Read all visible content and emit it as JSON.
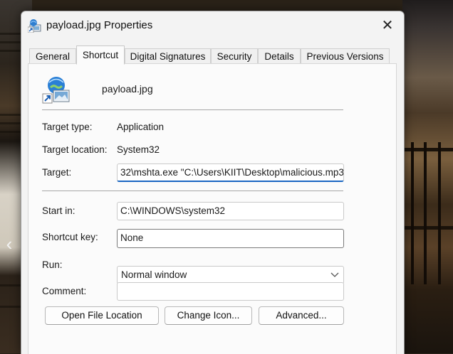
{
  "window": {
    "title": "payload.jpg Properties",
    "close_glyph": "✕"
  },
  "tabs": [
    {
      "label": "General"
    },
    {
      "label": "Shortcut",
      "active": true
    },
    {
      "label": "Digital Signatures"
    },
    {
      "label": "Security"
    },
    {
      "label": "Details"
    },
    {
      "label": "Previous Versions"
    }
  ],
  "shortcut": {
    "file_name": "payload.jpg",
    "target_type_label": "Target type:",
    "target_type": "Application",
    "target_location_label": "Target location:",
    "target_location": "System32",
    "target_label": "Target:",
    "target": "32\\mshta.exe \"C:\\Users\\KIIT\\Desktop\\malicious.mp3\"",
    "start_in_label": "Start in:",
    "start_in": "C:\\WINDOWS\\system32",
    "shortcut_key_label": "Shortcut key:",
    "shortcut_key": "None",
    "run_label": "Run:",
    "run": "Normal window",
    "comment_label": "Comment:",
    "comment": ""
  },
  "buttons": {
    "open_file_location": "Open File Location",
    "change_icon": "Change Icon...",
    "advanced": "Advanced..."
  },
  "background": {
    "nav_arrow": "‹"
  },
  "colors": {
    "accent": "#1a66c2",
    "dialog_bg": "#f3f3f3",
    "panel_bg": "#fbfbfb"
  },
  "icons": {
    "title": "shortcut-app-icon",
    "file": "shortcut-globe-icon",
    "run_dropdown": "chevron-down-icon"
  }
}
